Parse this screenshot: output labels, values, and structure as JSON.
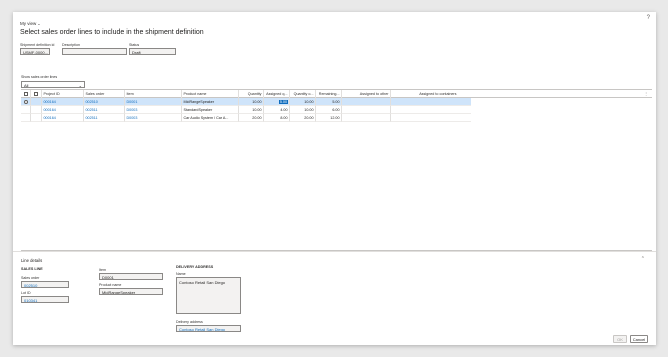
{
  "header": {
    "view_label": "My view",
    "help_icon": "?",
    "title": "Select sales order lines to include in the shipment definition"
  },
  "fields": {
    "shipment_definition_label": "Shipment definition id",
    "shipment_definition_value": "USMF-0000...",
    "description_label": "Description",
    "description_value": "",
    "status_label": "Status",
    "status_value": "Draft"
  },
  "filter": {
    "label": "Show sales order lines",
    "value": "All"
  },
  "grid": {
    "columns": [
      "Project ID",
      "Sales order",
      "Item",
      "Product name",
      "Quantity",
      "Assigned q...",
      "Quantity o...",
      "Remaining...",
      "Assigned to other",
      "Assigned to containers"
    ],
    "rows": [
      {
        "project_id": "000164",
        "sales_order": "002510",
        "item": "D0001",
        "product_name": "MidRangeSpeaker",
        "quantity": "10.00",
        "assigned_q": "5.00",
        "quantity_o": "10.00",
        "remaining": "5.00",
        "assigned_other": "",
        "assigned_containers": ""
      },
      {
        "project_id": "000164",
        "sales_order": "002511",
        "item": "D0003",
        "product_name": "StandardSpeaker",
        "quantity": "10.00",
        "assigned_q": "4.00",
        "quantity_o": "10.00",
        "remaining": "6.00",
        "assigned_other": "",
        "assigned_containers": ""
      },
      {
        "project_id": "000164",
        "sales_order": "002511",
        "item": "D0003",
        "product_name": "Car Audio System / Car A...",
        "quantity": "20.00",
        "assigned_q": "8.00",
        "quantity_o": "20.00",
        "remaining": "12.00",
        "assigned_other": "",
        "assigned_containers": ""
      }
    ]
  },
  "line_details": {
    "title": "Line details",
    "sales_line_heading": "SALES LINE",
    "sales_order_label": "Sales order",
    "sales_order_value": "002510",
    "lot_id_label": "Lot ID",
    "lot_id_value": "010341",
    "item_label": "Item",
    "item_value": "D0001",
    "product_name_label": "Product name",
    "product_name_value": "MidRangeSpeaker",
    "delivery_heading": "DELIVERY ADDRESS",
    "name_label": "Name",
    "name_value": "Contoso Retail San Diego",
    "delivery_address_label": "Delivery address",
    "delivery_address_value": "Contoso Retail San Diego"
  },
  "buttons": {
    "ok": "OK",
    "cancel": "Cancel"
  }
}
